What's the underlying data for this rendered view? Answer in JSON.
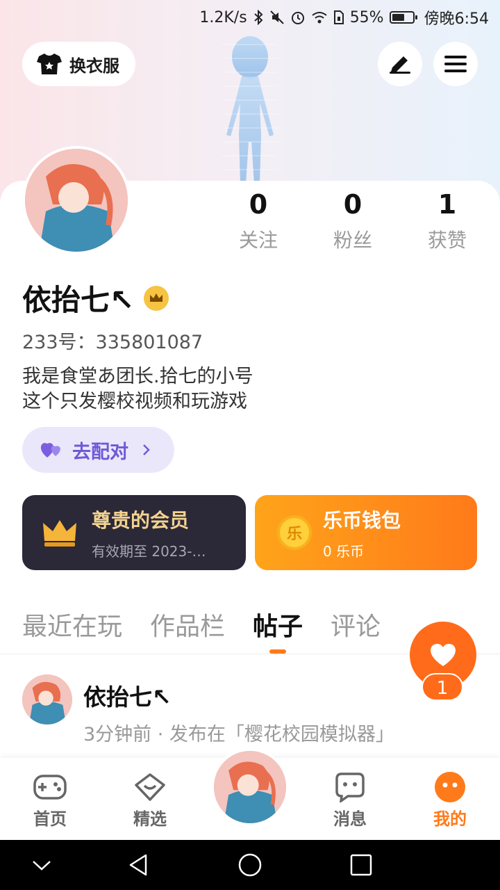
{
  "status_bar": {
    "net_speed": "1.2K/s",
    "battery_pct": "55%",
    "time": "傍晚6:54",
    "icons": [
      "bluetooth-icon",
      "mute-icon",
      "alarm-icon",
      "wifi-icon",
      "sim-icon",
      "battery-icon"
    ]
  },
  "header": {
    "outfit_label": "换衣服",
    "edit_icon": "edit-icon",
    "menu_icon": "menu-icon"
  },
  "stats": [
    {
      "value": "0",
      "label": "关注"
    },
    {
      "value": "0",
      "label": "粉丝"
    },
    {
      "value": "1",
      "label": "获赞"
    }
  ],
  "profile": {
    "name": "依抬七↖",
    "uid": "233号：335801087",
    "bio_line1": "我是食堂あ团长.拾七的小号",
    "bio_line2": "这个只发樱校视频和玩游戏",
    "pair_label": "去配对"
  },
  "vip": {
    "title": "尊贵的会员",
    "subtitle": "有效期至 2023-…"
  },
  "wallet": {
    "coin_glyph": "乐",
    "title": "乐币钱包",
    "subtitle": "0 乐币"
  },
  "tabs": [
    {
      "label": "最近在玩",
      "active": false
    },
    {
      "label": "作品栏",
      "active": false
    },
    {
      "label": "帖子",
      "active": true
    },
    {
      "label": "评论",
      "active": false
    }
  ],
  "like_fab": {
    "count": "1"
  },
  "post": {
    "author": "依抬七↖",
    "meta": "3分钟前 · 发布在「樱花校园模拟器」"
  },
  "bottom_nav": [
    {
      "label": "首页",
      "icon": "gamepad-icon",
      "active": false
    },
    {
      "label": "精选",
      "icon": "heart-box-icon",
      "active": false
    },
    {
      "label": "消息",
      "icon": "message-icon",
      "active": false
    },
    {
      "label": "我的",
      "icon": "profile-dots-icon",
      "active": true
    }
  ],
  "colors": {
    "accent": "#ff7a1a",
    "vip_bg": "#2b2838",
    "pair_bg": "#ebe7fb",
    "pair_text": "#6e5ad6"
  }
}
